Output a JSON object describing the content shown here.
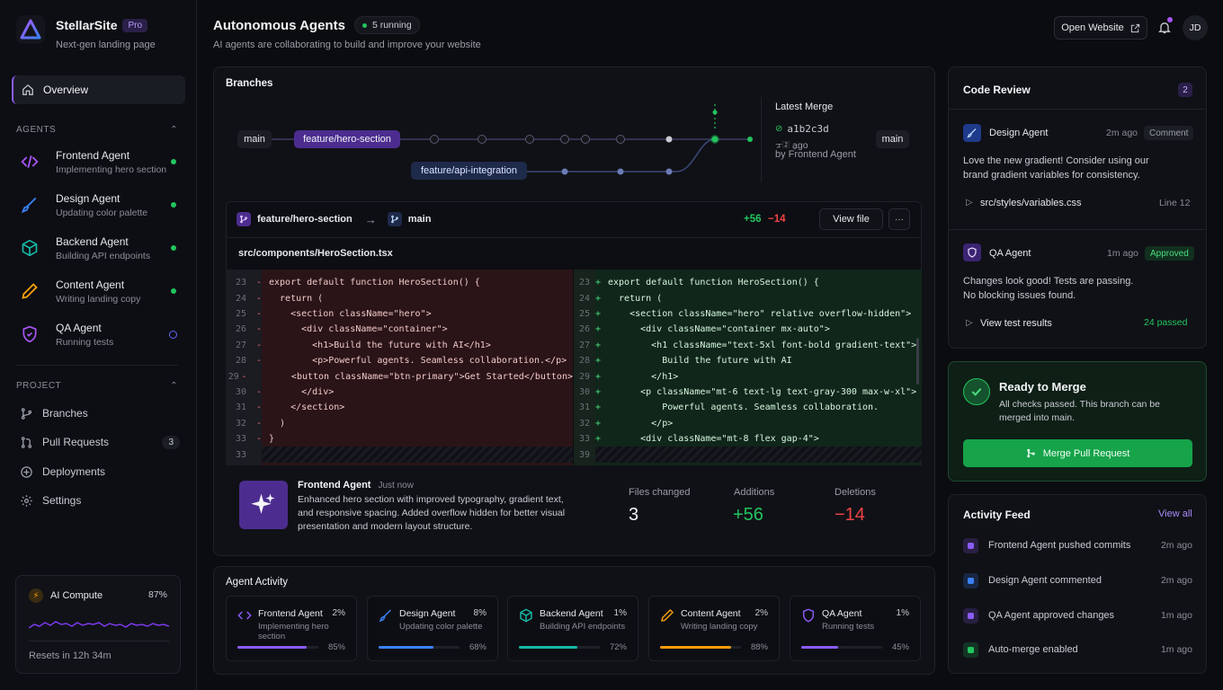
{
  "brand": {
    "name": "StellarSite",
    "badge": "Pro",
    "tagline": "Next-gen landing page"
  },
  "nav": {
    "overview": "Overview"
  },
  "agents_section": {
    "label": "AGENTS"
  },
  "agents": [
    {
      "name": "Frontend Agent",
      "status": "Implementing hero section",
      "state": "active",
      "color": "#a855f7"
    },
    {
      "name": "Design Agent",
      "status": "Updating color palette",
      "state": "active",
      "color": "#3b82f6"
    },
    {
      "name": "Backend Agent",
      "status": "Building API endpoints",
      "state": "active",
      "color": "#14b8a6"
    },
    {
      "name": "Content Agent",
      "status": "Writing landing copy",
      "state": "active",
      "color": "#f59e0b"
    },
    {
      "name": "QA Agent",
      "status": "Running tests",
      "state": "idle",
      "color": "#8b5cf6"
    }
  ],
  "project_section": {
    "label": "PROJECT"
  },
  "project": [
    {
      "label": "Branches",
      "icon": "branch-icon"
    },
    {
      "label": "Pull Requests",
      "icon": "pull-request-icon",
      "count": "3"
    },
    {
      "label": "Deployments",
      "icon": "deploy-icon"
    },
    {
      "label": "Settings",
      "icon": "gear-icon"
    }
  ],
  "compute": {
    "label": "AI Compute",
    "percent": "87%",
    "reset": "Resets in 12h 34m"
  },
  "header": {
    "title": "Autonomous Agents",
    "running": "5 running",
    "subtitle": "AI agents are collaborating to build and improve your website",
    "open_site": "Open Website",
    "avatar": "JD"
  },
  "branches": {
    "title": "Branches",
    "main_left": "main",
    "feature_hero": "feature/hero-section",
    "feature_api": "feature/api-integration",
    "main_right": "main",
    "latest_merge_label": "Latest Merge",
    "merge_hash": "a1b2c3d",
    "merge_time": "ᠴ᠌ a̱go",
    "merge_by": "by Frontend Agent"
  },
  "diff": {
    "from_branch": "feature/hero-section",
    "to_branch": "main",
    "additions": "+56",
    "deletions": "−14",
    "view_file": "View file",
    "more": "···",
    "file_path": "src/components/HeroSection.tsx",
    "left_lines": [
      {
        "n": "23",
        "code": "export default function HeroSection() {"
      },
      {
        "n": "24",
        "code": "  return ("
      },
      {
        "n": "25",
        "code": "    <section className=\"hero\">"
      },
      {
        "n": "26",
        "code": "      <div className=\"container\">"
      },
      {
        "n": "27",
        "code": "        <h1>Build the future with AI</h1>"
      },
      {
        "n": "28",
        "code": "        <p>Powerful agents. Seamless collaboration.</p>"
      },
      {
        "n": "29",
        "code": "        <button className=\"btn-primary\">Get Started</button>"
      },
      {
        "n": "30",
        "code": "      </div>"
      },
      {
        "n": "31",
        "code": "    </section>"
      },
      {
        "n": "32",
        "code": "  )"
      },
      {
        "n": "33",
        "code": "}"
      },
      {
        "n": "33",
        "code": ""
      }
    ],
    "right_lines": [
      {
        "n": "23",
        "code": "export default function HeroSection() {"
      },
      {
        "n": "24",
        "code": "  return ("
      },
      {
        "n": "25",
        "code": "    <section className=\"hero\" relative overflow-hidden\">"
      },
      {
        "n": "26",
        "code": "      <div className=\"container mx-auto\">"
      },
      {
        "n": "27",
        "code": "        <h1 className=\"text-5xl font-bold gradient-text\">"
      },
      {
        "n": "28",
        "code": "          Build the future with AI"
      },
      {
        "n": "29",
        "code": "        </h1>"
      },
      {
        "n": "30",
        "code": "      <p className=\"mt-6 text-lg text-gray-300 max-w-xl\">"
      },
      {
        "n": "31",
        "code": "          Powerful agents. Seamless collaboration."
      },
      {
        "n": "32",
        "code": "        </p>"
      },
      {
        "n": "33",
        "code": "      <div className=\"mt-8 flex gap-4\">"
      },
      {
        "n": "39",
        "code": ""
      }
    ]
  },
  "commit": {
    "author": "Frontend Agent",
    "time": "Just now",
    "message": "Enhanced hero section with improved typography, gradient text, and responsive spacing. Added overflow hidden for better visual presentation and modern layout structure.",
    "files_label": "Files changed",
    "files_value": "3",
    "additions_label": "Additions",
    "additions_value": "+56",
    "deletions_label": "Deletions",
    "deletions_value": "−14"
  },
  "activity": {
    "title": "Agent Activity",
    "cards": [
      {
        "name": "Frontend Agent",
        "pct": "2%",
        "status": "Implementing hero section",
        "progress": 0.85,
        "value": "85%",
        "color": "#8b5cf6"
      },
      {
        "name": "Design Agent",
        "pct": "8%",
        "status": "Updating color palette",
        "progress": 0.68,
        "value": "68%",
        "color": "#3b82f6"
      },
      {
        "name": "Backend Agent",
        "pct": "1%",
        "status": "Building API endpoints",
        "progress": 0.72,
        "value": "72%",
        "color": "#14b8a6"
      },
      {
        "name": "Content Agent",
        "pct": "2%",
        "status": "Writing landing copy",
        "progress": 0.88,
        "value": "88%",
        "color": "#f59e0b"
      },
      {
        "name": "QA Agent",
        "pct": "1%",
        "status": "Running tests",
        "progress": 0.45,
        "value": "45%",
        "color": "#8b5cf6"
      }
    ]
  },
  "review": {
    "title": "Code Review",
    "count": "2",
    "items": [
      {
        "agent": "Design Agent",
        "time": "2m ago",
        "tag": "Comment",
        "text": "Love the new gradient! Consider using our brand gradient variables for consistency.",
        "link": "src/styles/variables.css",
        "meta": "Line 12"
      },
      {
        "agent": "QA Agent",
        "time": "1m ago",
        "tag": "Approved",
        "text": "Changes look good! Tests are passing. No blocking issues found.",
        "link": "View test results",
        "meta": "24 passed"
      }
    ]
  },
  "merge": {
    "title": "Ready to Merge",
    "text": "All checks passed. This branch can be merged into main.",
    "button": "Merge Pull Request"
  },
  "feed": {
    "title": "Activity Feed",
    "view_all": "View all",
    "items": [
      {
        "text": "Frontend Agent pushed commits",
        "time": "2m ago",
        "color": "#8b5cf6"
      },
      {
        "text": "Design Agent commented",
        "time": "2m ago",
        "color": "#3b82f6"
      },
      {
        "text": "QA Agent approved changes",
        "time": "1m ago",
        "color": "#8b5cf6"
      },
      {
        "text": "Auto-merge enabled",
        "time": "1m ago",
        "color": "#22c55e"
      }
    ]
  },
  "colors": {
    "accent": "#8b5cf6",
    "success": "#22c55e",
    "danger": "#ef4444",
    "bg": "#0b0c10"
  }
}
